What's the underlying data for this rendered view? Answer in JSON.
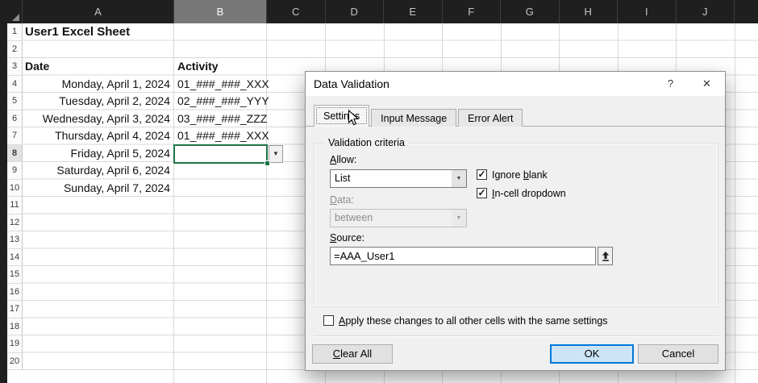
{
  "sheet": {
    "columns": [
      "A",
      "B",
      "C",
      "D",
      "E",
      "F",
      "G",
      "H",
      "I",
      "J"
    ],
    "row_numbers": [
      "1",
      "2",
      "3",
      "4",
      "5",
      "6",
      "7",
      "8",
      "9",
      "10",
      "11",
      "12",
      "13",
      "14",
      "15",
      "16",
      "17",
      "18",
      "19",
      "20"
    ],
    "cells": {
      "title": "User1 Excel Sheet",
      "date_header": "Date",
      "activity_header": "Activity"
    },
    "rows": [
      {
        "date": "Monday, April 1, 2024",
        "activity": "01_###_###_XXX"
      },
      {
        "date": "Tuesday, April 2, 2024",
        "activity": "02_###_###_YYY"
      },
      {
        "date": "Wednesday, April 3, 2024",
        "activity": "03_###_###_ZZZ"
      },
      {
        "date": "Thursday, April 4, 2024",
        "activity": "01_###_###_XXX"
      },
      {
        "date": "Friday, April 5, 2024",
        "activity": ""
      },
      {
        "date": "Saturday, April 6, 2024",
        "activity": ""
      },
      {
        "date": "Sunday, April 7, 2024",
        "activity": ""
      }
    ],
    "selection": {
      "cell": "B8",
      "column": "B",
      "row": "8"
    }
  },
  "dialog": {
    "title": "Data Validation",
    "help_label": "?",
    "close_label": "✕",
    "tabs": [
      {
        "label": "Settings"
      },
      {
        "label": "Input Message"
      },
      {
        "label": "Error Alert"
      }
    ],
    "active_tab": "Settings",
    "criteria": {
      "group_label": "Validation criteria",
      "allow_label": "&Allow:",
      "allow_value": "List",
      "ignore_blank_label": "Ignore &blank",
      "ignore_blank_checked": true,
      "incell_label": "&In-cell dropdown",
      "incell_checked": true,
      "data_label": "&Data:",
      "data_value": "between",
      "source_label": "&Source:",
      "source_value": "=AAA_User1"
    },
    "apply_label": "&Apply these changes to all other cells with the same settings",
    "apply_checked": false,
    "buttons": {
      "clear_all": "&Clear All",
      "ok": "OK",
      "cancel": "Cancel"
    }
  },
  "icons": {
    "dropdown_arrow": "▼",
    "select_all_corner": "corner-triangle",
    "range_selector": "collapse-up-arrow"
  },
  "colors": {
    "selection_green": "#217346",
    "ok_border_blue": "#0078d7",
    "ok_fill_blue": "#cce4f7",
    "header_dark": "#1f1f1f"
  }
}
